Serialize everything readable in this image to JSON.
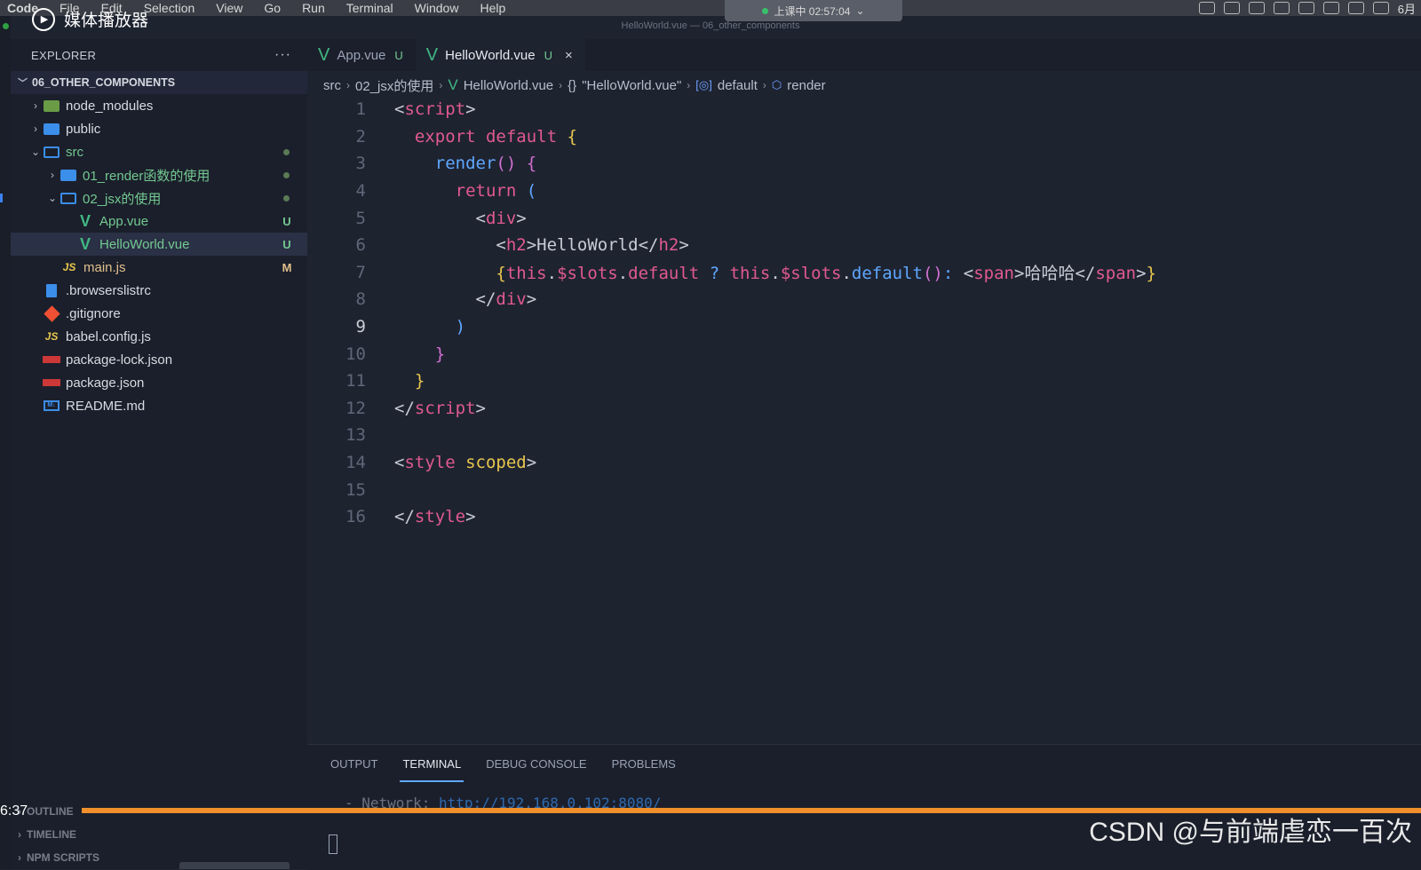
{
  "menubar": {
    "app": "Code",
    "items": [
      "File",
      "Edit",
      "Selection",
      "View",
      "Go",
      "Run",
      "Terminal",
      "Window",
      "Help"
    ],
    "clock": "上课中 02:57:04",
    "battery": "6月"
  },
  "media_overlay": {
    "label": "媒体播放器"
  },
  "window_title": "HelloWorld.vue — 06_other_components",
  "explorer": {
    "title": "EXPLORER",
    "more": "···",
    "root": "06_OTHER_COMPONENTS",
    "items": [
      {
        "label": "node_modules",
        "icon": "node-folder-icon",
        "status": ""
      },
      {
        "label": "public",
        "icon": "folder-icon",
        "status": ""
      },
      {
        "label": "src",
        "icon": "folder-open-icon",
        "status": ""
      },
      {
        "label": "01_render函数的使用",
        "icon": "folder-icon",
        "status": ""
      },
      {
        "label": "02_jsx的使用",
        "icon": "folder-open-icon",
        "status": ""
      },
      {
        "label": "App.vue",
        "icon": "vue-icon",
        "status": "U"
      },
      {
        "label": "HelloWorld.vue",
        "icon": "vue-icon",
        "status": "U"
      },
      {
        "label": "main.js",
        "icon": "js-icon",
        "status": "M"
      },
      {
        "label": ".browserslistrc",
        "icon": "file-icon",
        "status": ""
      },
      {
        "label": ".gitignore",
        "icon": "git-icon",
        "status": ""
      },
      {
        "label": "babel.config.js",
        "icon": "js-icon",
        "status": ""
      },
      {
        "label": "package-lock.json",
        "icon": "npm-icon",
        "status": ""
      },
      {
        "label": "package.json",
        "icon": "npm-icon",
        "status": ""
      },
      {
        "label": "README.md",
        "icon": "markdown-icon",
        "status": ""
      }
    ],
    "sections": [
      "OUTLINE",
      "TIMELINE",
      "NPM SCRIPTS"
    ]
  },
  "tabs": [
    {
      "label": "App.vue",
      "status": "U"
    },
    {
      "label": "HelloWorld.vue",
      "status": "U",
      "close": "×"
    }
  ],
  "breadcrumb": {
    "src": "src",
    "folder": "02_jsx的使用",
    "file": "HelloWorld.vue",
    "section": "\"HelloWorld.vue\"",
    "section_icon": "{}",
    "symbol": "default",
    "method": "render"
  },
  "code": {
    "line_numbers": [
      "1",
      "2",
      "3",
      "4",
      "5",
      "6",
      "7",
      "8",
      "9",
      "10",
      "11",
      "12",
      "13",
      "14",
      "15",
      "16"
    ],
    "current_line": "9"
  },
  "panel": {
    "tabs": [
      "OUTPUT",
      "TERMINAL",
      "DEBUG CONSOLE",
      "PROBLEMS"
    ],
    "active_tab": "TERMINAL",
    "terminal_prefix": "- Network: ",
    "terminal_url": "http://192.168.0.102:8080/"
  },
  "video": {
    "time": "6:37",
    "watermark": "CSDN @与前端虐恋一百次",
    "progress_color": "#f08f2c"
  }
}
